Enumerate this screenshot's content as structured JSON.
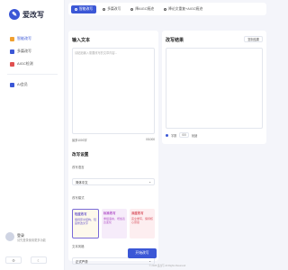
{
  "app": {
    "title": "爱改写"
  },
  "sidebar": {
    "items": [
      {
        "label": "智能改写",
        "icon": "edit-icon",
        "color": "#f0a030",
        "active": true
      },
      {
        "label": "多篇改写",
        "icon": "docs-icon",
        "color": "#3b57d6"
      },
      {
        "label": "AIGC检测",
        "icon": "check-icon",
        "color": "#e05050"
      },
      {
        "label": "AI会员",
        "icon": "member-icon",
        "color": "#3b57d6"
      }
    ],
    "user": {
      "name": "登录",
      "sub": "请先登录使用更多功能"
    },
    "actions": [
      "⚙",
      "☾"
    ]
  },
  "tabs": [
    {
      "label": "智能改写",
      "active": true
    },
    {
      "label": "多篇改写"
    },
    {
      "label": "降AIGC痕迹"
    },
    {
      "label": "降论文重复+AIGC痕迹"
    }
  ],
  "editor": {
    "title": "输入文本",
    "placeholder": "请粘贴输入需要改写的文章内容...",
    "count_label": "最多1000字",
    "count_value": "0/1000",
    "settings_title": "改写设置",
    "language_label": "改写语言",
    "language_value": "简体中文",
    "mode_label": "改写模式",
    "modes": [
      {
        "title": "轻度改写",
        "desc": "保持原文结构，轻度修改文字"
      },
      {
        "title": "标准改写",
        "desc": "重组语言，增加表达变化"
      },
      {
        "title": "深度改写",
        "desc": "完全重写，保持核心意思"
      }
    ],
    "style_label": "文本风格",
    "style_value": "正式严谨",
    "submit_label": "开始改写"
  },
  "result": {
    "title": "改写结果",
    "copy_label": "复制结果",
    "foot_label": "字数",
    "foot_chip": "0/0",
    "foot_status": "就绪"
  },
  "footer": {
    "text": "© 2025 爱改写 All Rights Reserved"
  }
}
